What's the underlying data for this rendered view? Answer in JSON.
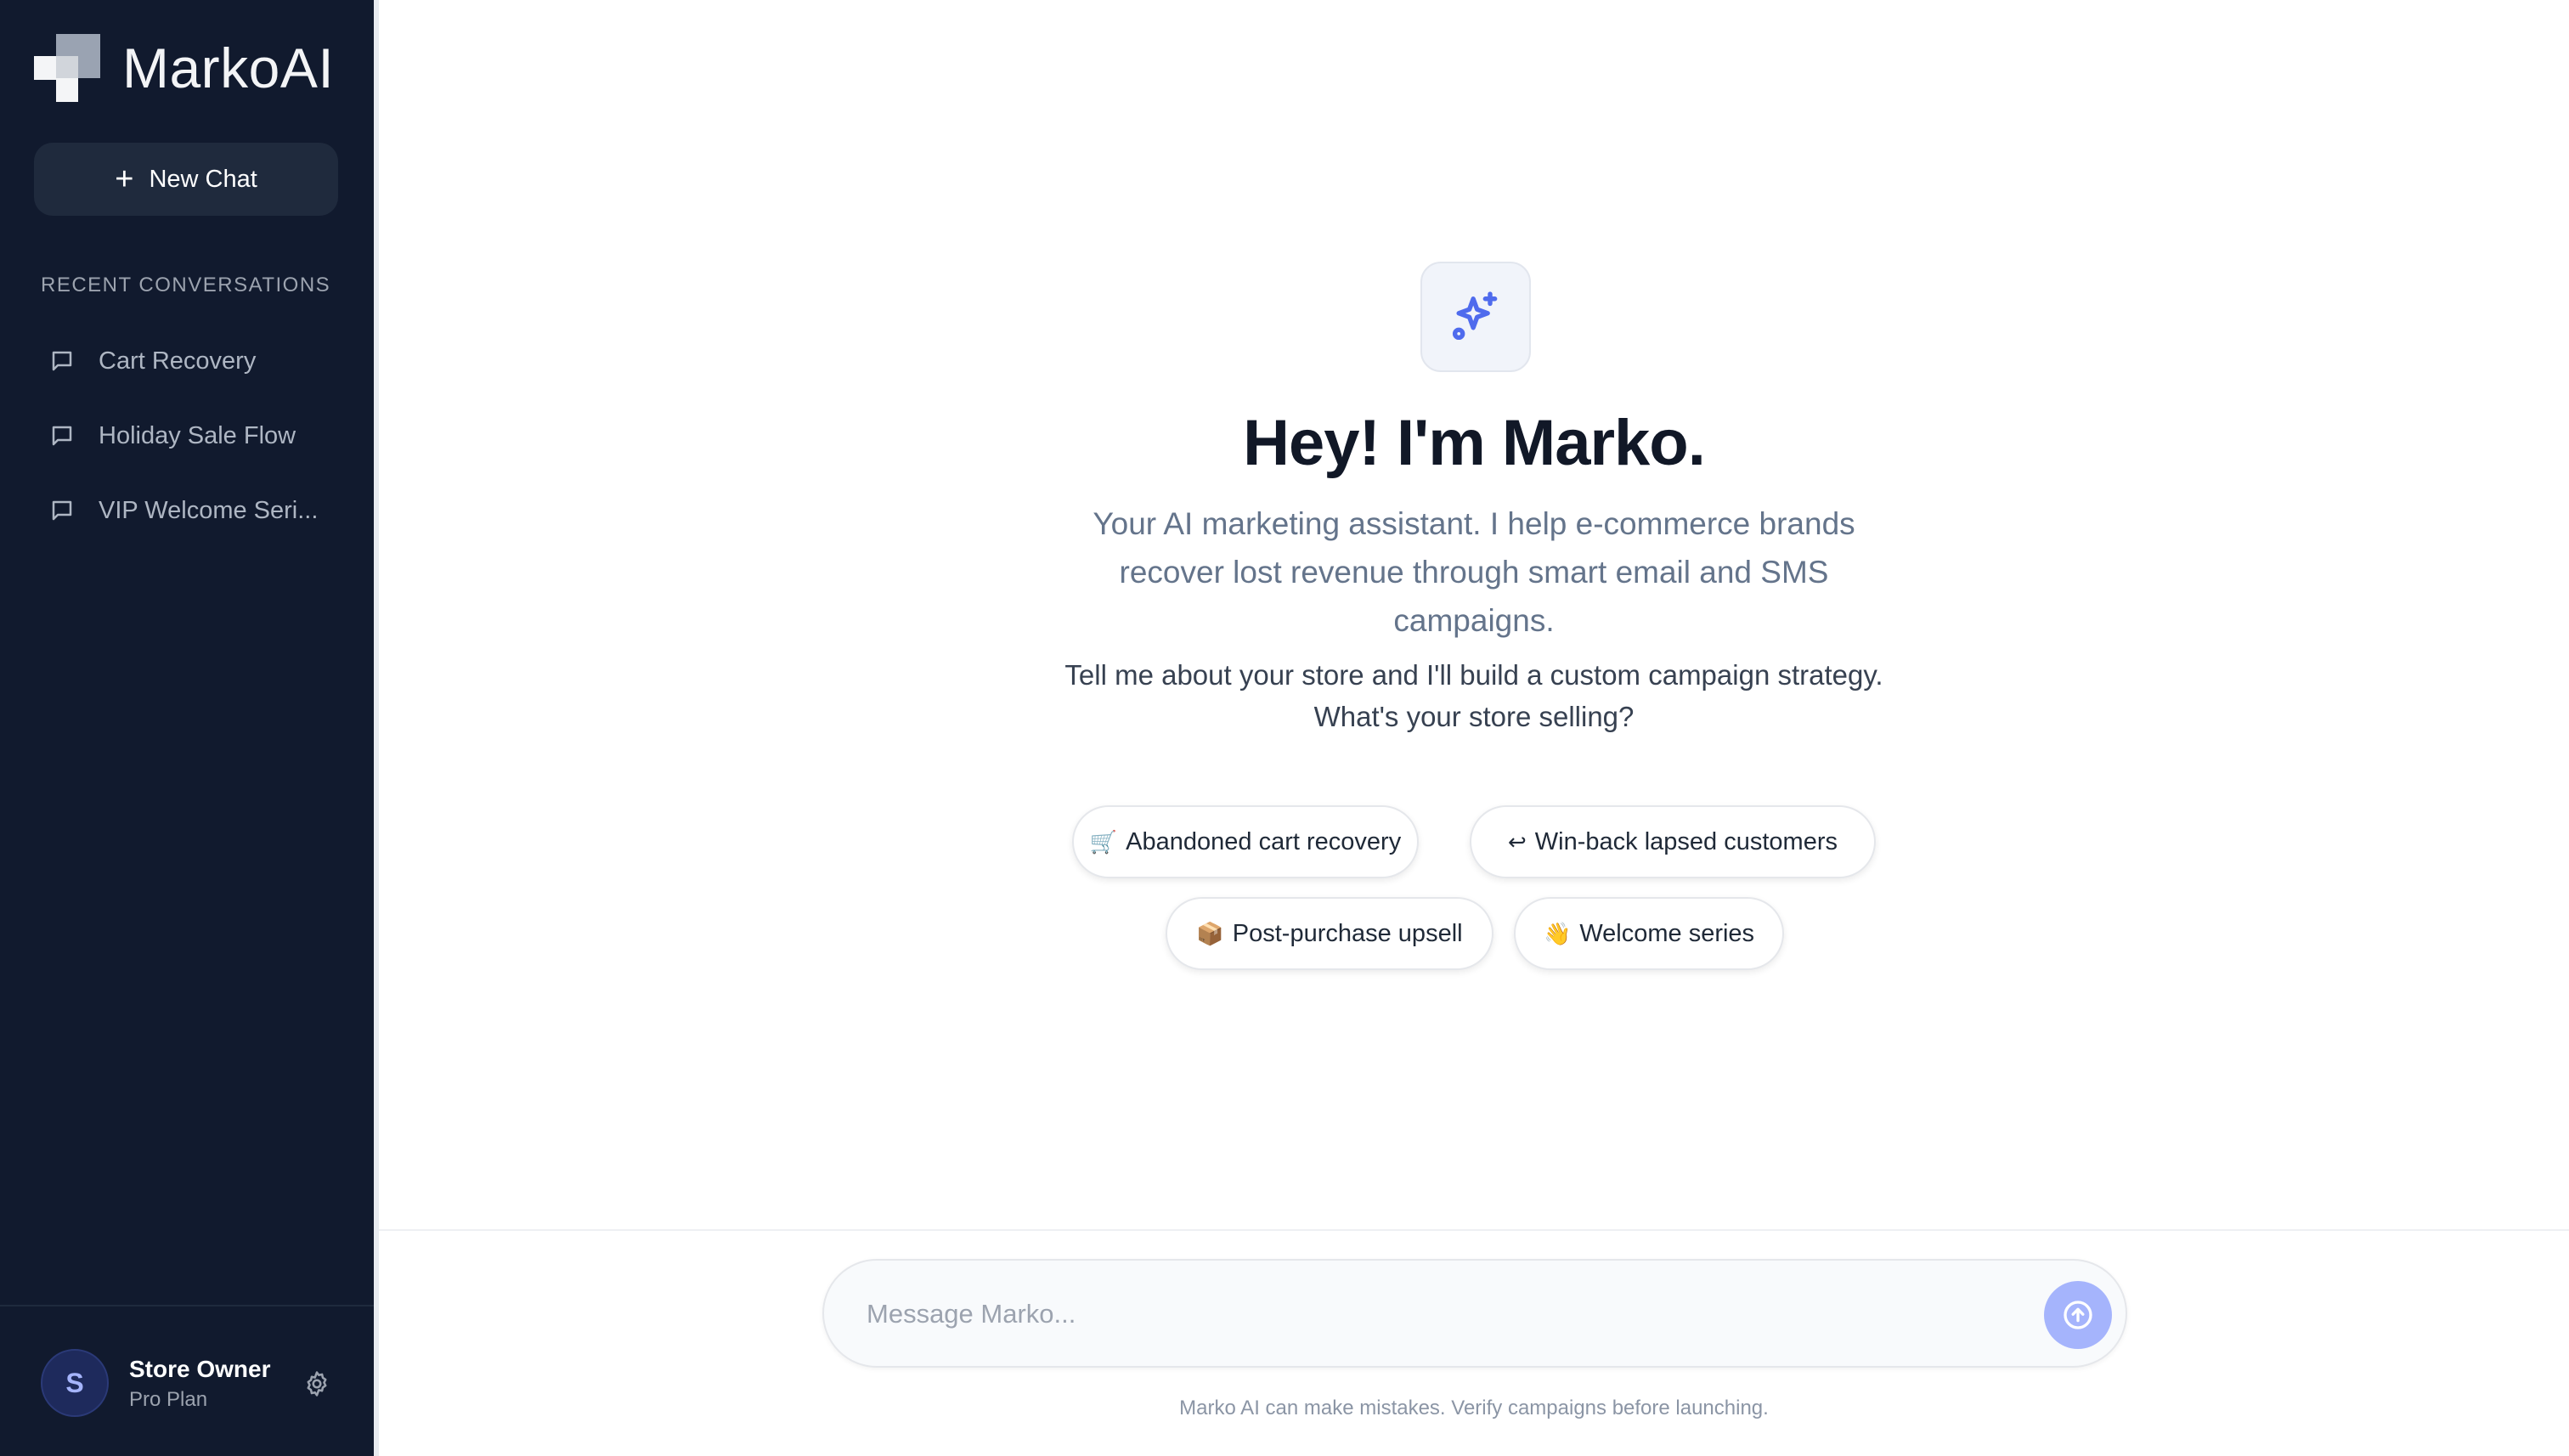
{
  "brand": {
    "name": "MarkoAI"
  },
  "sidebar": {
    "new_chat_label": "New Chat",
    "section_label": "RECENT CONVERSATIONS",
    "conversations": [
      {
        "label": "Cart Recovery"
      },
      {
        "label": "Holiday Sale Flow"
      },
      {
        "label": "VIP Welcome Seri..."
      }
    ],
    "user": {
      "initial": "S",
      "name": "Store Owner",
      "plan": "Pro Plan"
    }
  },
  "main": {
    "headline": "Hey! I'm Marko.",
    "subtitle": "Your AI marketing assistant. I help e-commerce brands recover lost revenue through smart email and SMS campaigns.",
    "prompt_line1": "Tell me about your store and I'll build a custom campaign strategy.",
    "prompt_line2": "What's your store selling?",
    "chips": [
      {
        "emoji": "🛒",
        "label": "Abandoned cart recovery"
      },
      {
        "emoji": "↩",
        "label": "Win-back lapsed customers"
      },
      {
        "emoji": "📦",
        "label": "Post-purchase upsell"
      },
      {
        "emoji": "👋",
        "label": "Welcome series"
      }
    ],
    "input": {
      "placeholder": "Message Marko...",
      "value": ""
    },
    "disclaimer": "Marko AI can make mistakes. Verify campaigns before launching."
  },
  "colors": {
    "sidebar_bg": "#111a2e",
    "accent": "#4f6bed",
    "send_button": "#a5b4fc"
  },
  "icons": {
    "hero": "sparkles-icon",
    "conversation": "chat-bubble-icon",
    "settings": "gear-icon",
    "send": "arrow-up-icon"
  }
}
